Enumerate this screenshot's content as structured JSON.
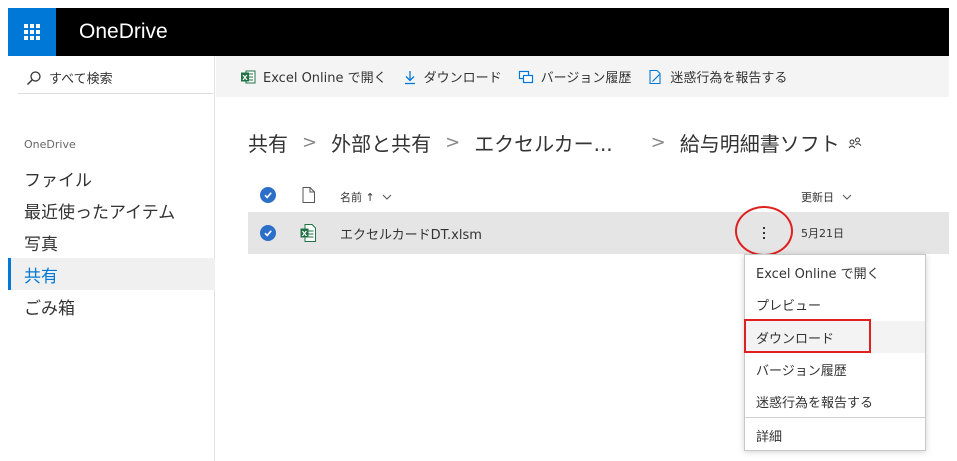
{
  "app": {
    "title": "OneDrive"
  },
  "sidebar": {
    "search_label": "すべて検索",
    "section_label": "OneDrive",
    "items": [
      {
        "label": "ファイル",
        "active": false
      },
      {
        "label": "最近使ったアイテム",
        "active": false
      },
      {
        "label": "写真",
        "active": false
      },
      {
        "label": "共有",
        "active": true
      },
      {
        "label": "ごみ箱",
        "active": false
      }
    ]
  },
  "toolbar": {
    "open_excel": "Excel Online で開く",
    "download": "ダウンロード",
    "version_history": "バージョン履歴",
    "report": "迷惑行為を報告する"
  },
  "breadcrumb": {
    "items": [
      "共有",
      "外部と共有",
      "エクセルカー...",
      "給与明細書ソフト"
    ],
    "separator": ">"
  },
  "list": {
    "columns": {
      "name": "名前 ↑",
      "modified": "更新日"
    },
    "rows": [
      {
        "name": "エクセルカードDT.xlsm",
        "modified": "5月21日",
        "selected": true
      }
    ]
  },
  "context_menu": {
    "items": [
      "Excel Online で開く",
      "プレビュー",
      "ダウンロード",
      "バージョン履歴",
      "迷惑行為を報告する",
      "詳細"
    ],
    "highlighted_index": 2
  },
  "colors": {
    "accent": "#0078d7",
    "topbar": "#000000",
    "excel_green": "#217346",
    "annotation_red": "#e02020"
  },
  "icons": {
    "app_launcher": "waffle-icon",
    "search": "search-icon",
    "excel": "excel-icon",
    "download": "download-icon",
    "versions": "version-history-icon",
    "report": "report-icon",
    "shared": "shared-people-icon",
    "more": "more-vertical-icon"
  }
}
